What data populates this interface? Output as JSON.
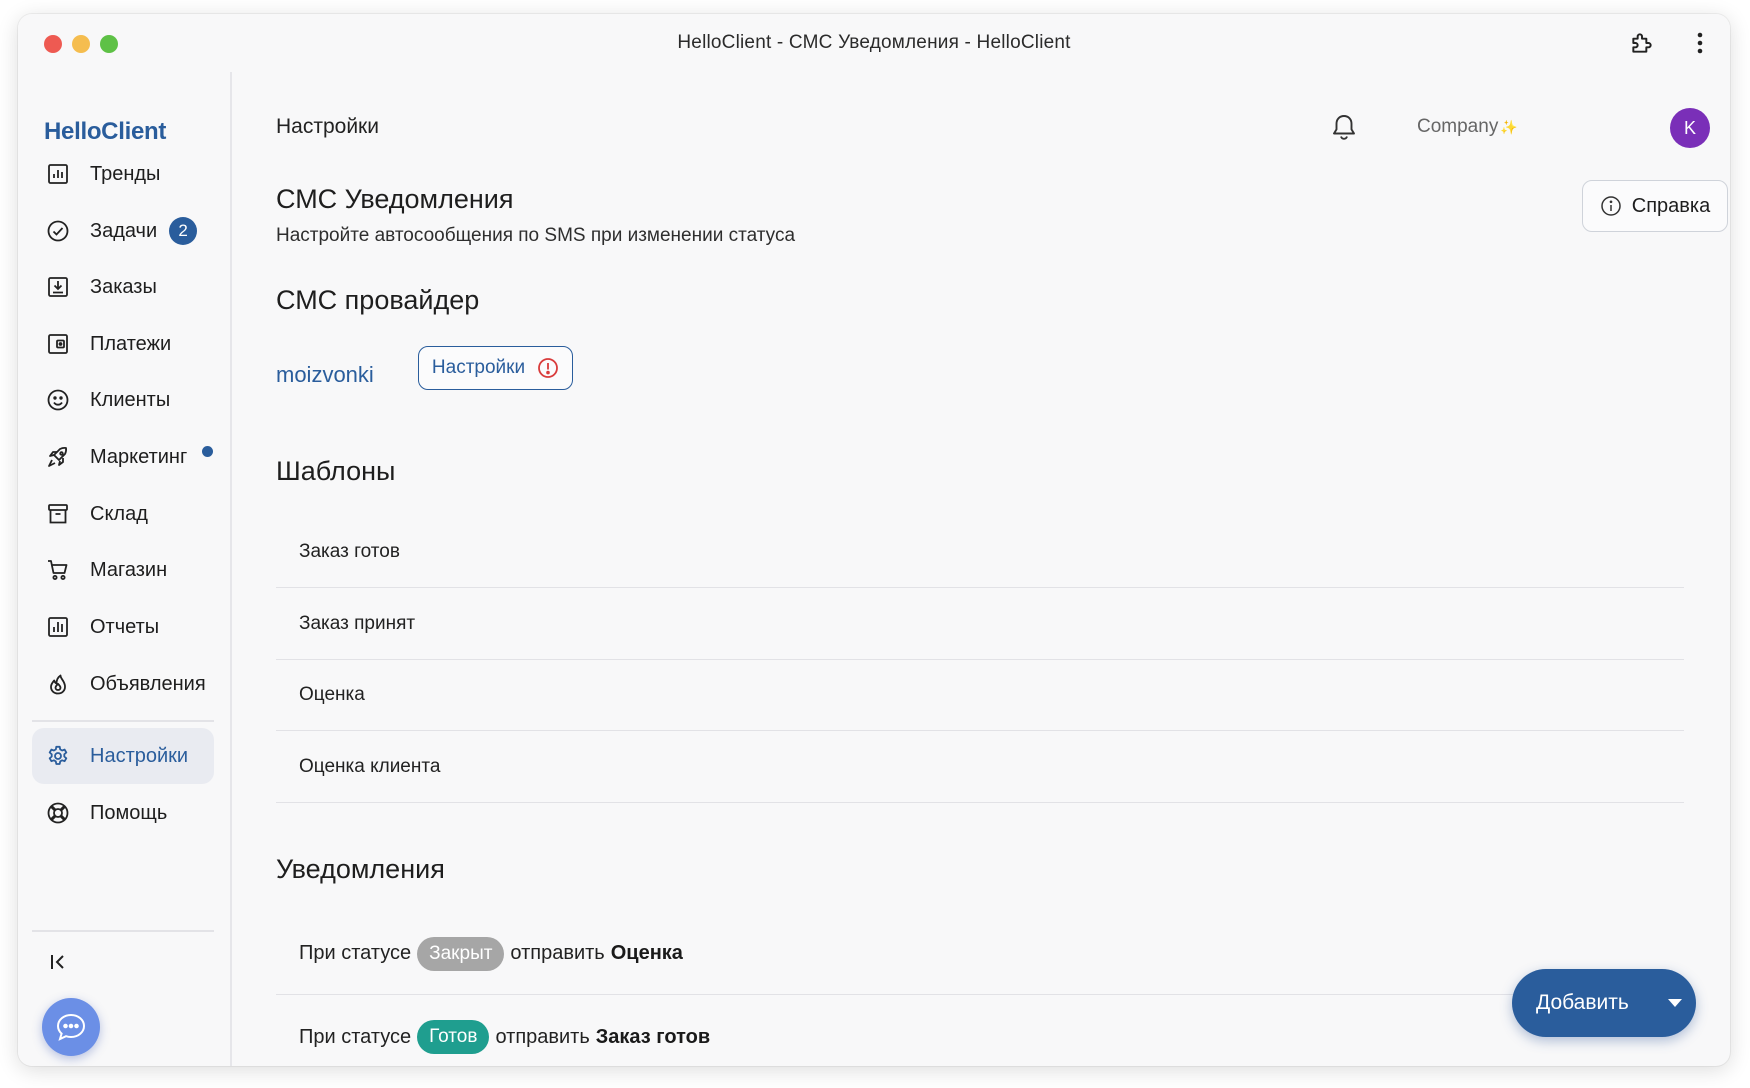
{
  "window": {
    "title": "HelloClient - СМС Уведомления - HelloClient"
  },
  "sidebar": {
    "logo": "HelloClient",
    "items": [
      {
        "label": "Тренды",
        "icon": "chart-icon"
      },
      {
        "label": "Задачи",
        "icon": "check-circle-icon",
        "badge": "2"
      },
      {
        "label": "Заказы",
        "icon": "download-box-icon"
      },
      {
        "label": "Платежи",
        "icon": "wallet-icon"
      },
      {
        "label": "Клиенты",
        "icon": "smile-icon"
      },
      {
        "label": "Маркетинг",
        "icon": "rocket-icon",
        "dot": true
      },
      {
        "label": "Склад",
        "icon": "archive-icon"
      },
      {
        "label": "Магазин",
        "icon": "cart-icon"
      },
      {
        "label": "Отчеты",
        "icon": "report-chart-icon"
      },
      {
        "label": "Объявления",
        "icon": "fire-icon"
      },
      {
        "label": "Настройки",
        "icon": "gear-icon",
        "active": true
      },
      {
        "label": "Помощь",
        "icon": "lifebuoy-icon"
      }
    ]
  },
  "header": {
    "title": "Настройки",
    "company": "Company",
    "avatar_letter": "K"
  },
  "page": {
    "title": "СМС Уведомления",
    "subtitle": "Настройте автосообщения по SMS при изменении статуса",
    "help_label": "Справка"
  },
  "provider": {
    "heading": "СМС провайдер",
    "name": "moizvonki",
    "settings_label": "Настройки"
  },
  "templates": {
    "heading": "Шаблоны",
    "items": [
      "Заказ готов",
      "Заказ принят",
      "Оценка",
      "Оценка клиента"
    ]
  },
  "notifications": {
    "heading": "Уведомления",
    "prefix": "При статусе",
    "middle": "отправить",
    "items": [
      {
        "status": "Закрыт",
        "status_color": "#a6a6a6",
        "template": "Оценка"
      },
      {
        "status": "Готов",
        "status_color": "#1f9e8f",
        "template": "Заказ готов"
      }
    ]
  },
  "add_button": {
    "label": "Добавить"
  },
  "colors": {
    "accent": "#2a5d9c",
    "avatar": "#7a2fb8"
  }
}
